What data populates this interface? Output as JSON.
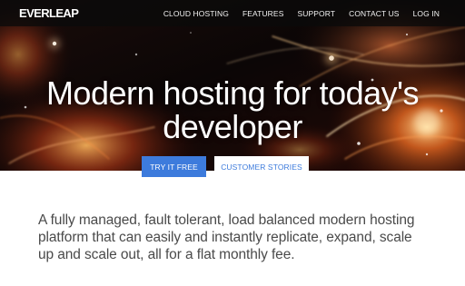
{
  "header": {
    "logo": "EVERLEAP",
    "nav": [
      {
        "label": "CLOUD HOSTING"
      },
      {
        "label": "FEATURES"
      },
      {
        "label": "SUPPORT"
      },
      {
        "label": "CONTACT US"
      },
      {
        "label": "LOG IN"
      }
    ]
  },
  "hero": {
    "title": "Modern hosting for today's developer",
    "primary_button": "TRY IT FREE",
    "secondary_button": "CUSTOMER STORIES"
  },
  "intro": {
    "text": "A fully managed, fault tolerant, load balanced modern hosting platform that can easily and instantly replicate, expand, scale up and scale out, all for a flat monthly fee."
  },
  "colors": {
    "accent": "#3d7bdc",
    "navbar": "#0a0a0a",
    "body_text": "#4a4a4a"
  }
}
